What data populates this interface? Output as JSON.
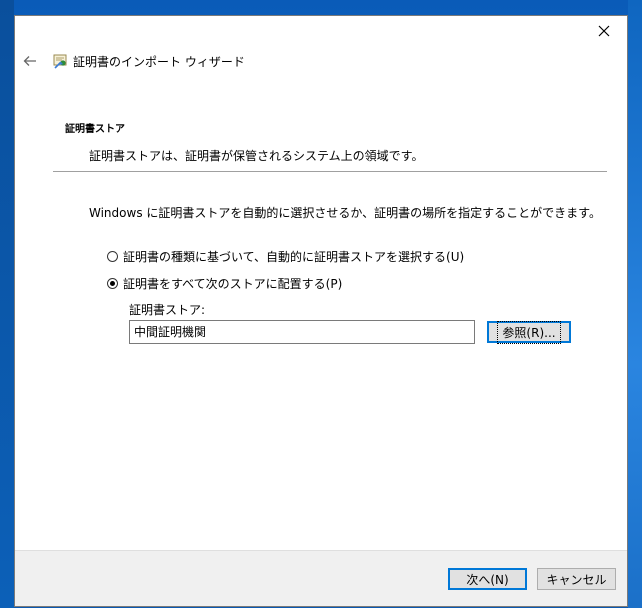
{
  "window": {
    "title": "証明書のインポート ウィザード",
    "close_symbol": "✕",
    "back_symbol": "←"
  },
  "section": {
    "title": "証明書ストア",
    "description": "証明書ストアは、証明書が保管されるシステム上の領域です。"
  },
  "instruction": "Windows に証明書ストアを自動的に選択させるか、証明書の場所を指定することができます。",
  "options": [
    {
      "label": "証明書の種類に基づいて、自動的に証明書ストアを選択する(U)",
      "checked": false
    },
    {
      "label": "証明書をすべて次のストアに配置する(P)",
      "checked": true
    }
  ],
  "store": {
    "label": "証明書ストア:",
    "value": "中間証明機関"
  },
  "buttons": {
    "browse": "参照(R)...",
    "next": "次へ(N)",
    "cancel": "キャンセル"
  },
  "colors": {
    "accent": "#0078d7",
    "desktop": "#0b66c8",
    "footer": "#f0f0f0"
  }
}
